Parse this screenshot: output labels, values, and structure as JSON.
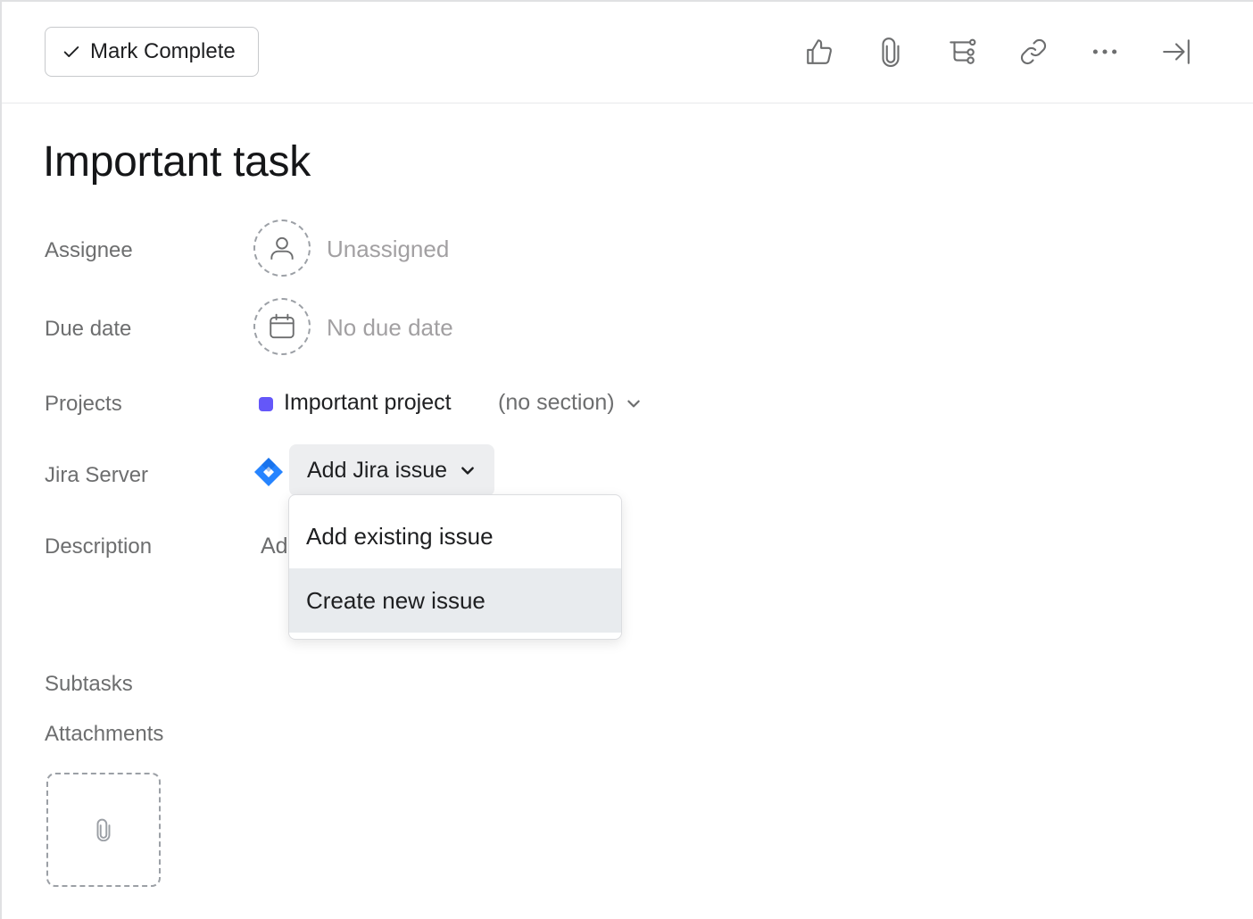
{
  "toolbar": {
    "mark_complete_label": "Mark Complete",
    "icons": [
      "thumbs-up-icon",
      "paperclip-icon",
      "subtask-icon",
      "link-icon",
      "more-icon",
      "close-pane-icon"
    ]
  },
  "task": {
    "title": "Important task"
  },
  "fields": {
    "assignee_label": "Assignee",
    "assignee_value": "Unassigned",
    "due_label": "Due date",
    "due_value": "No due date",
    "projects_label": "Projects",
    "project_name": "Important project",
    "project_section": "(no section)",
    "jira_label": "Jira Server",
    "jira_button": "Add Jira issue",
    "description_label": "Description",
    "description_placeholder": "Ad",
    "subtasks_label": "Subtasks",
    "attachments_label": "Attachments"
  },
  "jira_menu": {
    "items": [
      {
        "label": "Add existing issue"
      },
      {
        "label": "Create new issue"
      }
    ]
  },
  "colors": {
    "project_dot": "#6457f9",
    "jira_blue": "#2684ff",
    "hover_bg": "#e8ebee"
  }
}
